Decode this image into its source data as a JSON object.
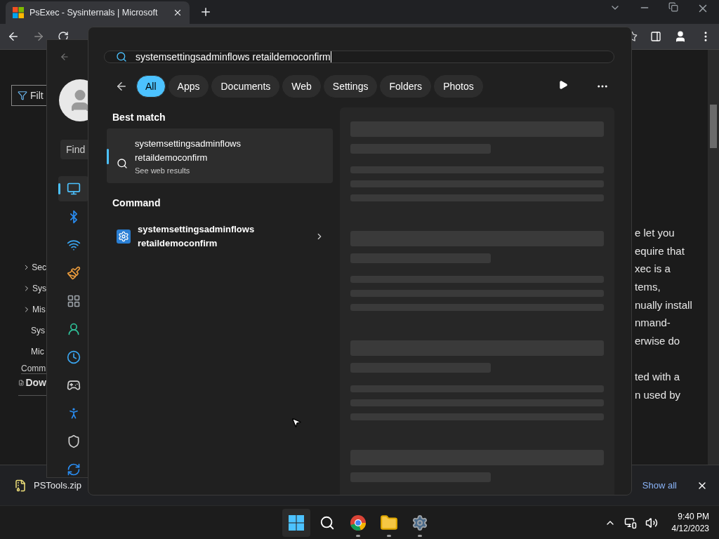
{
  "browser": {
    "tab": {
      "title": "PsExec - Sysinternals | Microsoft"
    },
    "toc": {
      "filter_placeholder": "Filt",
      "items": [
        {
          "label": "Sec",
          "expandable": true
        },
        {
          "label": "Sys",
          "expandable": true
        },
        {
          "label": "Mis",
          "expandable": true
        },
        {
          "label": "Sys",
          "expandable": false
        },
        {
          "label": "Mic",
          "expandable": false
        }
      ],
      "footer": "Comm",
      "download_link": "Dow"
    },
    "article_paragraphs": [
      [
        "e let you",
        "equire that",
        "xec is a",
        "tems,",
        "nually install",
        "nmand-",
        "erwise do"
      ],
      [
        "ted with a",
        "n used by"
      ]
    ],
    "download_bar": {
      "file": "PSTools.zip",
      "show_all": "Show all"
    }
  },
  "settings": {
    "find_placeholder": "Find",
    "nav": [
      {
        "kind": "display",
        "selected": true
      },
      {
        "kind": "bluetooth",
        "selected": false
      },
      {
        "kind": "network",
        "selected": false
      },
      {
        "kind": "personalization",
        "selected": false
      },
      {
        "kind": "apps",
        "selected": false
      },
      {
        "kind": "accounts",
        "selected": false
      },
      {
        "kind": "time",
        "selected": false
      },
      {
        "kind": "gaming",
        "selected": false
      },
      {
        "kind": "accessibility",
        "selected": false
      },
      {
        "kind": "privacy",
        "selected": false
      },
      {
        "kind": "update",
        "selected": false
      }
    ]
  },
  "search": {
    "query": "systemsettingsadminflows retaildemoconfirm",
    "filters": [
      {
        "label": "All",
        "selected": true
      },
      {
        "label": "Apps",
        "selected": false
      },
      {
        "label": "Documents",
        "selected": false
      },
      {
        "label": "Web",
        "selected": false
      },
      {
        "label": "Settings",
        "selected": false
      },
      {
        "label": "Folders",
        "selected": false
      },
      {
        "label": "Photos",
        "selected": false
      }
    ],
    "sections": [
      {
        "heading": "Best match",
        "items": [
          {
            "kind": "web",
            "lines": [
              "systemsettingsadminflows",
              "retaildemoconfirm"
            ],
            "subtitle": "See web results",
            "selected": true
          }
        ]
      },
      {
        "heading": "Command",
        "items": [
          {
            "kind": "command",
            "lines": [
              "systemsettingsadminflows",
              "retaildemoconfirm"
            ],
            "selected": false
          }
        ]
      }
    ]
  },
  "taskbar": {
    "apps": [
      {
        "kind": "start",
        "running": false
      },
      {
        "kind": "search",
        "running": false
      },
      {
        "kind": "chrome",
        "running": true
      },
      {
        "kind": "explorer",
        "running": true
      },
      {
        "kind": "settings",
        "running": true
      }
    ],
    "time": "9:40 PM",
    "date": "4/12/2023"
  }
}
